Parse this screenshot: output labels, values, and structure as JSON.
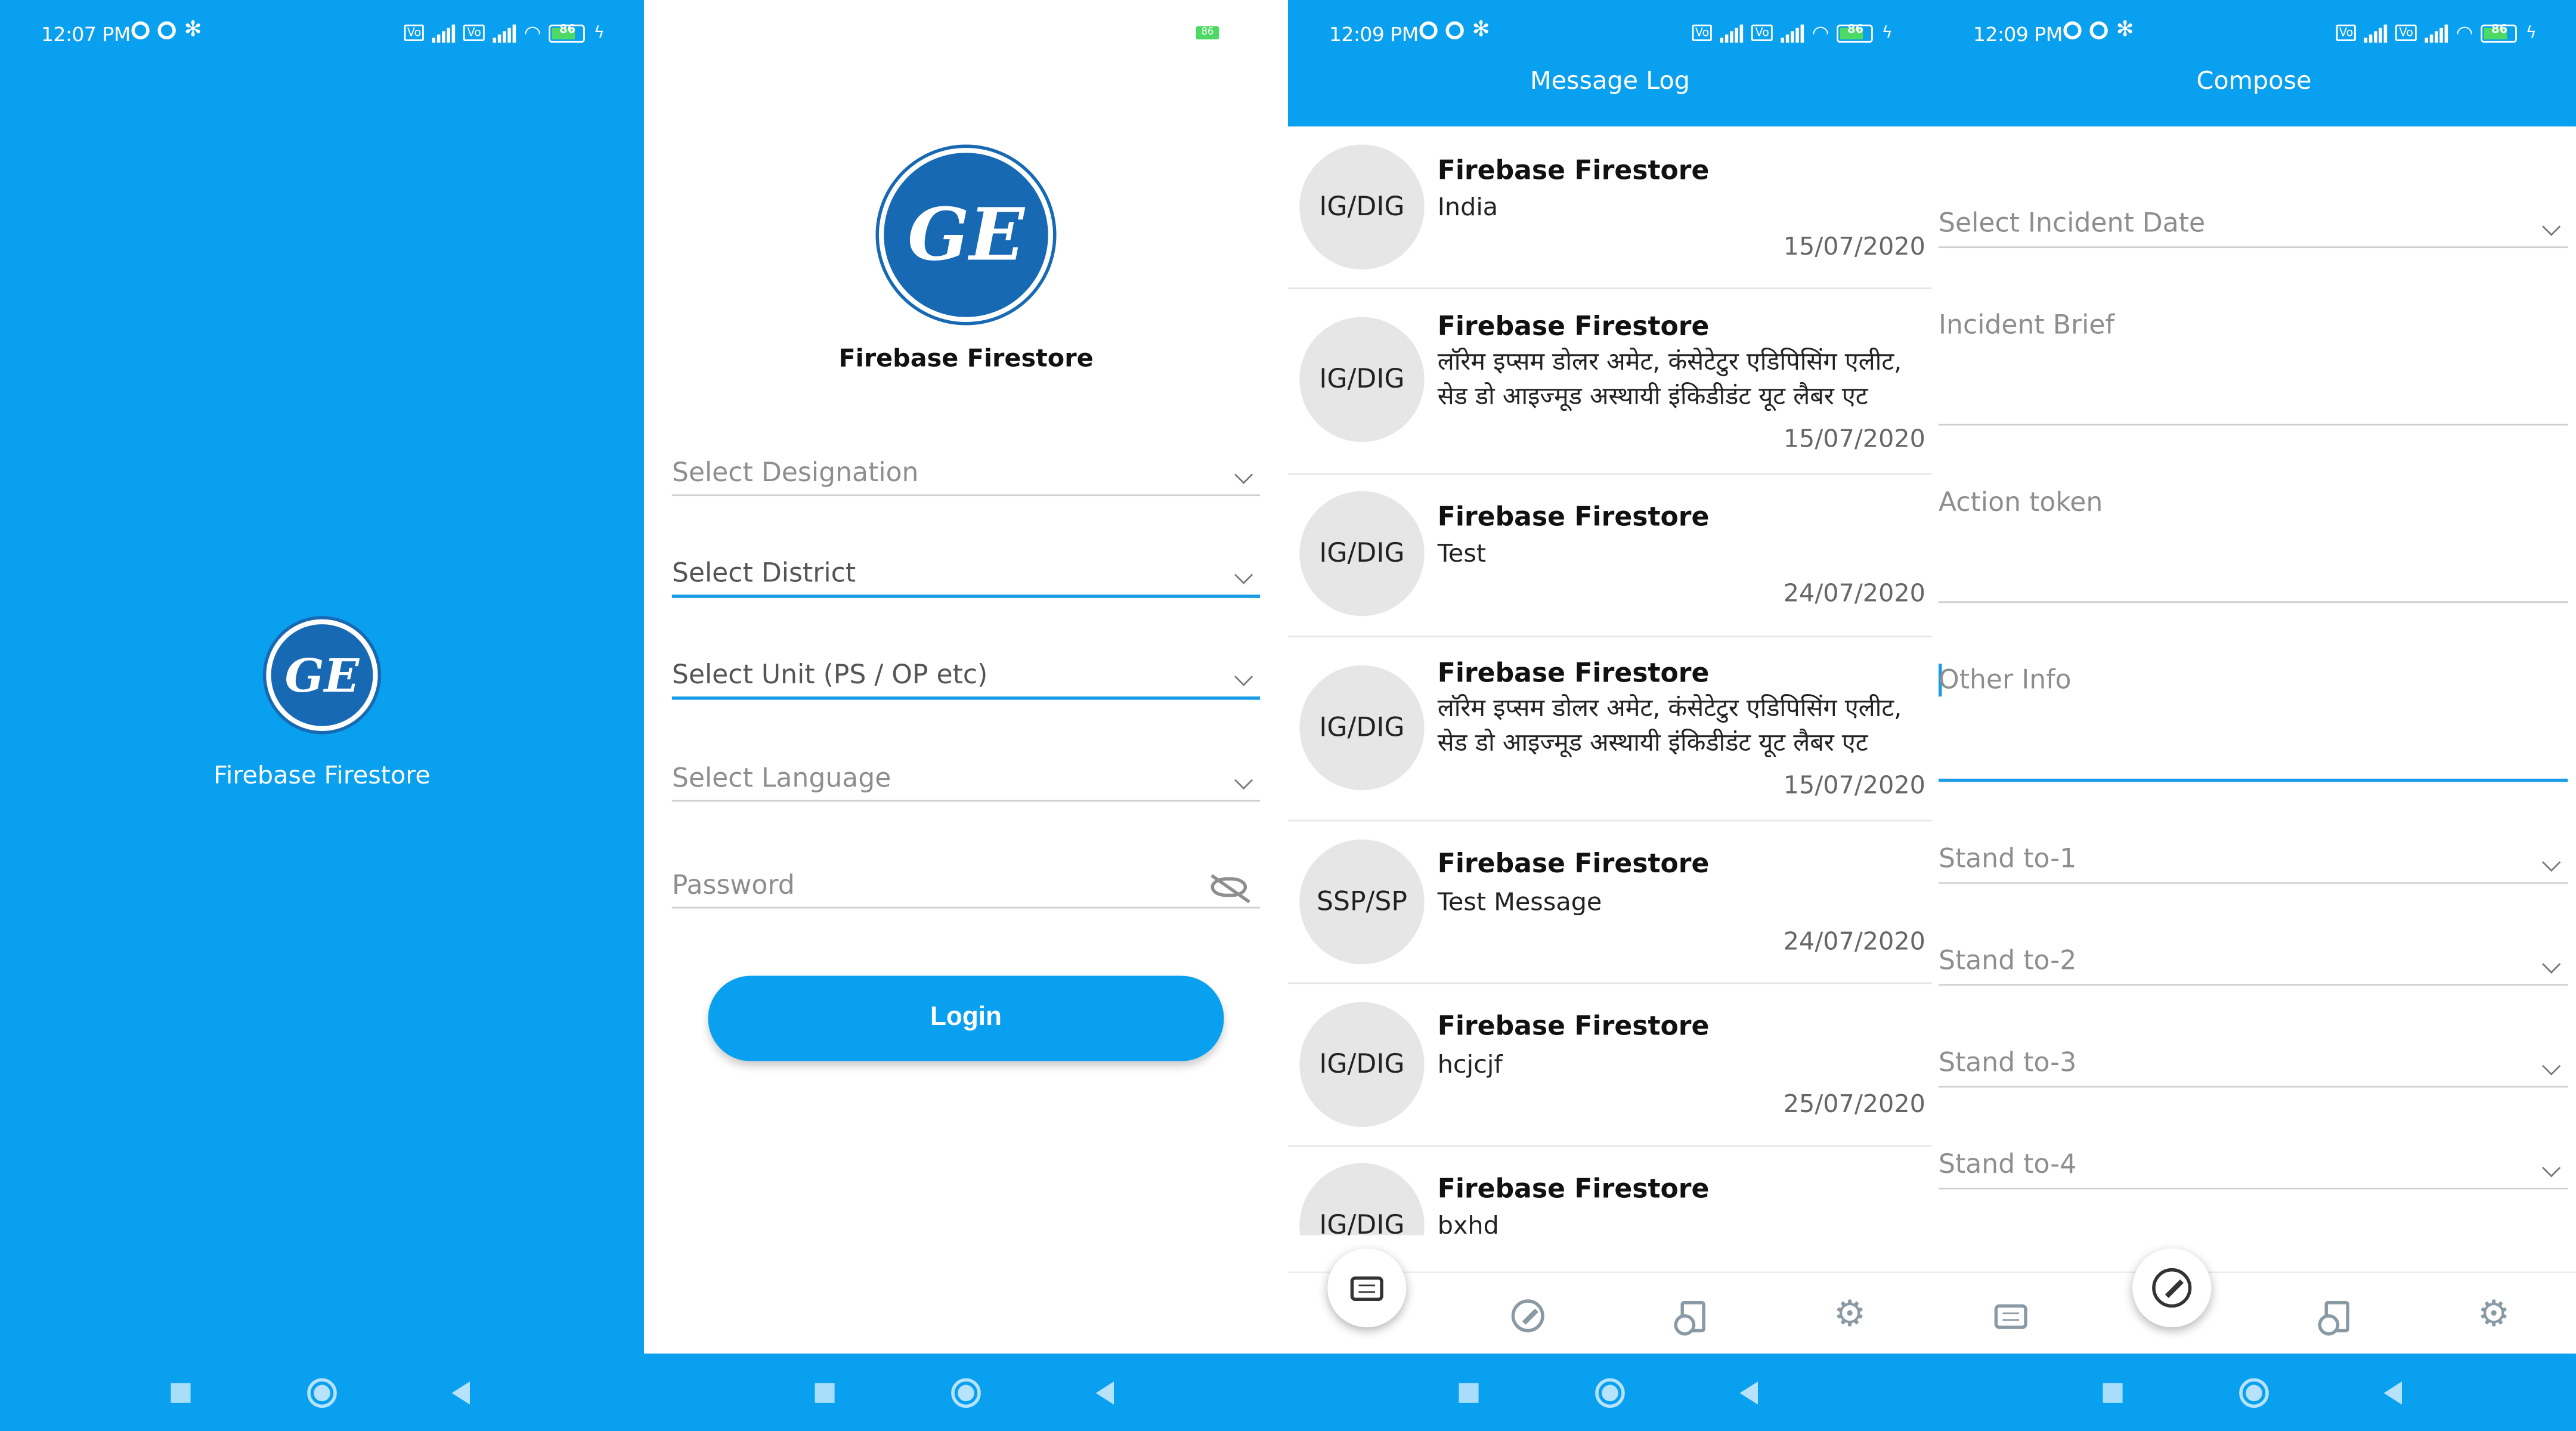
{
  "status": {
    "time_splash": "12:07 PM",
    "time_log": "12:09 PM",
    "time_compose": "12:09 PM",
    "battery": "86"
  },
  "app": {
    "name": "Firebase Firestore",
    "logo_text": "GE"
  },
  "login": {
    "fields": [
      {
        "label": "Select Designation"
      },
      {
        "label": "Select District"
      },
      {
        "label": "Select Unit (PS / OP etc)"
      },
      {
        "label": "Select Language"
      },
      {
        "label": "Password"
      }
    ],
    "login_button": "Login"
  },
  "message_log": {
    "title": "Message Log",
    "messages": [
      {
        "avatar": "IG/DIG",
        "sender": "Firebase Firestore",
        "body": "India",
        "date": "15/07/2020"
      },
      {
        "avatar": "IG/DIG",
        "sender": "Firebase Firestore",
        "body": "लॉरेम इप्सम डोलर अमेट, कंसेटेटुर एडिपिसिंग एलीट, सेड डो आइज्मूड अस्थायी इंकिडीडंट यूट लैबर एट",
        "date": "15/07/2020"
      },
      {
        "avatar": "IG/DIG",
        "sender": "Firebase Firestore",
        "body": "Test",
        "date": "24/07/2020"
      },
      {
        "avatar": "IG/DIG",
        "sender": "Firebase Firestore",
        "body": "लॉरेम इप्सम डोलर अमेट, कंसेटेटुर एडिपिसिंग एलीट, सेड डो आइज्मूड अस्थायी इंकिडीडंट यूट लैबर एट",
        "date": "15/07/2020"
      },
      {
        "avatar": "SSP/SP",
        "sender": "Firebase Firestore",
        "body": "Test Message",
        "date": "24/07/2020"
      },
      {
        "avatar": "IG/DIG",
        "sender": "Firebase Firestore",
        "body": "hcjcjf",
        "date": "25/07/2020"
      },
      {
        "avatar": "IG/DIG",
        "sender": "Firebase Firestore",
        "body": "bxhd",
        "date": ""
      }
    ]
  },
  "compose": {
    "title": "Compose",
    "fields": [
      {
        "label": "Select Incident Date"
      },
      {
        "label": "Incident Brief"
      },
      {
        "label": "Action token"
      },
      {
        "label": "Other Info"
      },
      {
        "label": "Stand to-1"
      },
      {
        "label": "Stand to-2"
      },
      {
        "label": "Stand to-3"
      },
      {
        "label": "Stand to-4"
      }
    ]
  },
  "bottom_nav": {
    "icons": [
      "chat-icon",
      "edit-icon",
      "document-icon",
      "settings-icon"
    ]
  },
  "colors": {
    "primary": "#0aa0f0",
    "logo_blue": "#1869b4",
    "focus_line": "#1a9be6"
  }
}
